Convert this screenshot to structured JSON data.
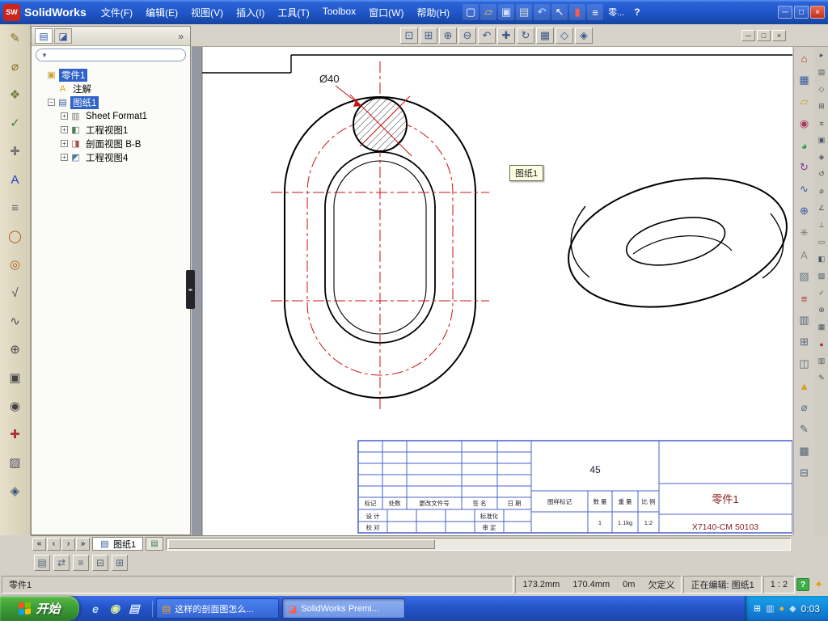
{
  "app": {
    "title": "SolidWorks",
    "logo_text": "SW"
  },
  "menubar": [
    "文件(F)",
    "编辑(E)",
    "视图(V)",
    "插入(I)",
    "工具(T)",
    "Toolbox",
    "窗口(W)",
    "帮助(H)"
  ],
  "titlebar": {
    "part_label": "零...",
    "help_label": "?",
    "tools": [
      {
        "name": "new-document-icon",
        "glyph": "▢",
        "color": "#ffffff"
      },
      {
        "name": "open-icon",
        "glyph": "▱",
        "color": "#f6c744"
      },
      {
        "name": "save-icon",
        "glyph": "▣",
        "color": "#cfe0ff"
      },
      {
        "name": "print-icon",
        "glyph": "▤",
        "color": "#d8dde4"
      },
      {
        "name": "undo-icon",
        "glyph": "↶",
        "color": "#bfe0ff"
      },
      {
        "name": "select-arrow-icon",
        "glyph": "↖",
        "color": "#ffffff"
      },
      {
        "name": "toggle-red-icon",
        "glyph": "▮",
        "color": "#ff5a4a"
      },
      {
        "name": "command-list-icon",
        "glyph": "≡",
        "color": "#ffffff"
      }
    ],
    "window_controls": {
      "minimize": "─",
      "restore": "□",
      "close": "×"
    }
  },
  "doc_toolbar": {
    "tools": [
      {
        "name": "zoom-fit-icon",
        "glyph": "⊡",
        "color": "#3a5a8e"
      },
      {
        "name": "zoom-area-icon",
        "glyph": "⊞",
        "color": "#3a5a8e"
      },
      {
        "name": "zoom-in-icon",
        "glyph": "⊕",
        "color": "#3a5a8e"
      },
      {
        "name": "zoom-out-icon",
        "glyph": "⊖",
        "color": "#3a5a8e"
      },
      {
        "name": "previous-view-icon",
        "glyph": "↶",
        "color": "#3a5a8e"
      },
      {
        "name": "pan-icon",
        "glyph": "✚",
        "color": "#3a5a8e"
      },
      {
        "name": "rotate-view-icon",
        "glyph": "↻",
        "color": "#3a5a8e"
      },
      {
        "name": "standard-views-icon",
        "glyph": "▦",
        "color": "#3a5a8e"
      },
      {
        "name": "wireframe-icon",
        "glyph": "◇",
        "color": "#3a5a8e"
      },
      {
        "name": "shaded-view-icon",
        "glyph": "◈",
        "color": "#3a5a8e"
      }
    ],
    "window_controls": {
      "minimize": "─",
      "restore": "□",
      "close": "×"
    }
  },
  "left_toolbar": [
    {
      "name": "sketch-icon",
      "glyph": "✎",
      "color": "#8a6d1f"
    },
    {
      "name": "smart-dimension-icon",
      "glyph": "⌀",
      "color": "#8a6d1f"
    },
    {
      "name": "model-items-icon",
      "glyph": "❖",
      "color": "#6b7f3a"
    },
    {
      "name": "spell-check-icon",
      "glyph": "✓",
      "color": "#3a7f3a"
    },
    {
      "name": "format-painter-icon",
      "glyph": "✚",
      "color": "#777777"
    },
    {
      "name": "note-icon",
      "glyph": "A",
      "color": "#1b3fbf"
    },
    {
      "name": "linear-note-pattern-icon",
      "glyph": "≡",
      "color": "#666666"
    },
    {
      "name": "balloon-icon",
      "glyph": "◯",
      "color": "#b05a1f"
    },
    {
      "name": "auto-balloon-icon",
      "glyph": "◎",
      "color": "#b05a1f"
    },
    {
      "name": "surface-finish-icon",
      "glyph": "√",
      "color": "#444444"
    },
    {
      "name": "weld-symbol-icon",
      "glyph": "∿",
      "color": "#444444"
    },
    {
      "name": "geometric-tolerance-icon",
      "glyph": "⊕",
      "color": "#444444"
    },
    {
      "name": "datum-feature-icon",
      "glyph": "▣",
      "color": "#444444"
    },
    {
      "name": "hole-callout-icon",
      "glyph": "◉",
      "color": "#444444"
    },
    {
      "name": "center-mark-icon",
      "glyph": "✚",
      "color": "#aa3333"
    },
    {
      "name": "area-hatch-icon",
      "glyph": "▨",
      "color": "#555566"
    },
    {
      "name": "block-icon",
      "glyph": "◈",
      "color": "#335577"
    }
  ],
  "right_toolbar_main": [
    {
      "name": "home-icon",
      "glyph": "⌂",
      "color": "#b03324"
    },
    {
      "name": "sheet-grid-icon",
      "glyph": "▦",
      "color": "#35589e"
    },
    {
      "name": "folder-icon",
      "glyph": "▱",
      "color": "#d8a020"
    },
    {
      "name": "view-orientation-icon",
      "glyph": "◉",
      "color": "#ac3a68"
    },
    {
      "name": "appearance-sphere-icon",
      "glyph": "◕",
      "color": "#2f9d4a"
    },
    {
      "name": "rebuild-icon",
      "glyph": "↻",
      "color": "#7a3a9d"
    },
    {
      "name": "spline-icon",
      "glyph": "∿",
      "color": "#35589e"
    },
    {
      "name": "insert-view-icon",
      "glyph": "⊕",
      "color": "#35589e"
    },
    {
      "name": "pattern-icon",
      "glyph": "✳",
      "color": "#777777"
    },
    {
      "name": "annotation-a-icon",
      "glyph": "A",
      "color": "#888888"
    },
    {
      "name": "hatch-icon",
      "glyph": "▧",
      "color": "#667788"
    },
    {
      "name": "note-list-icon",
      "glyph": "≡",
      "color": "#aa3333"
    },
    {
      "name": "table-icon",
      "glyph": "▥",
      "color": "#556677"
    },
    {
      "name": "grid-plus-icon",
      "glyph": "⊞",
      "color": "#556677"
    },
    {
      "name": "view-box-icon",
      "glyph": "◫",
      "color": "#556677"
    },
    {
      "name": "warning-icon",
      "glyph": "▲",
      "color": "#d8a020"
    },
    {
      "name": "diameter-dimension-icon",
      "glyph": "⌀",
      "color": "#556677"
    },
    {
      "name": "edit-icon",
      "glyph": "✎",
      "color": "#556677"
    },
    {
      "name": "layers-icon",
      "glyph": "▩",
      "color": "#556677"
    },
    {
      "name": "collapse-grid-icon",
      "glyph": "⊟",
      "color": "#556677"
    }
  ],
  "right_toolbar_outer": [
    {
      "name": "panel-toggle-icon",
      "glyph": "▸",
      "color": "#445566"
    },
    {
      "name": "doc-small-icon",
      "glyph": "▤",
      "color": "#445566"
    },
    {
      "name": "sketch-entity-icon",
      "glyph": "◇",
      "color": "#445566"
    },
    {
      "name": "add-grid-icon",
      "glyph": "⊞",
      "color": "#445566"
    },
    {
      "name": "list-small-icon",
      "glyph": "≡",
      "color": "#445566"
    },
    {
      "name": "solid-icon",
      "glyph": "▣",
      "color": "#445566"
    },
    {
      "name": "gem-icon",
      "glyph": "◈",
      "color": "#445566"
    },
    {
      "name": "undo-small-icon",
      "glyph": "↺",
      "color": "#445566"
    },
    {
      "name": "diameter-small-icon",
      "glyph": "⌀",
      "color": "#445566"
    },
    {
      "name": "angle-icon",
      "glyph": "∠",
      "color": "#445566"
    },
    {
      "name": "perpendicular-icon",
      "glyph": "⊥",
      "color": "#445566"
    },
    {
      "name": "rectangle-icon",
      "glyph": "▭",
      "color": "#445566"
    },
    {
      "name": "half-view-icon",
      "glyph": "◧",
      "color": "#445566"
    },
    {
      "name": "hatch-small-icon",
      "glyph": "▨",
      "color": "#445566"
    },
    {
      "name": "check-icon",
      "glyph": "✓",
      "color": "#2f7d3a"
    },
    {
      "name": "plus-icon",
      "glyph": "⊕",
      "color": "#445566"
    },
    {
      "name": "grid-small-icon",
      "glyph": "▦",
      "color": "#445566"
    },
    {
      "name": "record-icon",
      "glyph": "●",
      "color": "#aa3333"
    },
    {
      "name": "table-small-icon",
      "glyph": "▥",
      "color": "#445566"
    },
    {
      "name": "pencil-small-icon",
      "glyph": "✎",
      "color": "#445566"
    }
  ],
  "feature_panel": {
    "tabs": [
      {
        "name": "featuremanager-tab",
        "glyph": "▤"
      },
      {
        "name": "propertymanager-tab",
        "glyph": "◪"
      }
    ],
    "collapse_label": "»",
    "filter_glyph": "▼",
    "tree": {
      "root": {
        "label": "零件1",
        "glyph": "▣"
      },
      "annotations": {
        "label": "注解",
        "glyph": "A"
      },
      "sheet": {
        "label": "图纸1",
        "glyph": "▤",
        "expander": "−"
      },
      "children": [
        {
          "label": "Sheet Format1",
          "glyph": "▥",
          "expander": "+"
        },
        {
          "label": "工程视图1",
          "glyph": "◧",
          "expander": "+"
        },
        {
          "label": "剖面视图 B-B",
          "glyph": "◨",
          "expander": "+"
        },
        {
          "label": "工程视图4",
          "glyph": "◩",
          "expander": "+"
        }
      ]
    }
  },
  "drawing": {
    "dimension_label": "Ø40",
    "tooltip": "图纸1",
    "line_colors": {
      "outline": "#000000",
      "centerline": "#cc1111",
      "table": "#4a5fd0"
    },
    "title_block": {
      "material": "45",
      "part_name": "零件1",
      "drawing_number": "X7140-CM 50103",
      "change_header": [
        "标记",
        "处数",
        "更改文件号",
        "签 名",
        "日 期"
      ],
      "sig_labels_left": [
        "设 计",
        "校 对"
      ],
      "sig_labels_right": [
        "标准化",
        "审 定"
      ],
      "stamp_header": [
        "图样标记",
        "数 量",
        "重 量",
        "比 例"
      ],
      "stamp_values": [
        "",
        "1",
        "1.1kg",
        "1:2"
      ]
    }
  },
  "sheet_bar": {
    "nav": [
      {
        "name": "first-sheet-button",
        "glyph": "«"
      },
      {
        "name": "prev-sheet-button",
        "glyph": "‹"
      },
      {
        "name": "next-sheet-button",
        "glyph": "›"
      },
      {
        "name": "last-sheet-button",
        "glyph": "»"
      }
    ],
    "tab": {
      "label": "图纸1",
      "glyph": "▤"
    },
    "extra_tab_glyph": "▤"
  },
  "lower_toolbar": [
    {
      "name": "comment-icon",
      "glyph": "▤",
      "color": "#556677"
    },
    {
      "name": "swap-icon",
      "glyph": "⇄",
      "color": "#556677"
    },
    {
      "name": "line-format-icon",
      "glyph": "≡",
      "color": "#556677"
    },
    {
      "name": "layer-icon",
      "glyph": "⊟",
      "color": "#556677"
    },
    {
      "name": "grid-icon",
      "glyph": "⊞",
      "color": "#556677"
    }
  ],
  "status_bar": {
    "part": "零件1",
    "x": "173.2mm",
    "y": "170.4mm",
    "z": "0m",
    "dof": "欠定义",
    "editing": "正在编辑: 图纸1",
    "scale": "1 : 2",
    "help_glyph": "?",
    "lock_glyph": "✦"
  },
  "taskbar": {
    "start_label": "开始",
    "quick_launch": [
      {
        "name": "internet-explorer-icon",
        "glyph": "e",
        "color": "#bfe0ff"
      },
      {
        "name": "messenger-icon",
        "glyph": "◉",
        "color": "#d8e8a0"
      },
      {
        "name": "document-shortcut-icon",
        "glyph": "▤",
        "color": "#cfe0ff"
      }
    ],
    "tasks": [
      {
        "label": "这样的剖面图怎么...",
        "icon_glyph": "▤",
        "icon_color": "#f0a030"
      },
      {
        "label": "SolidWorks Premi...",
        "icon_glyph": "◪",
        "icon_color": "#ff5a4a"
      }
    ],
    "tray_icons": [
      {
        "name": "language-icon",
        "glyph": "⊞",
        "color": "#ffffff"
      },
      {
        "name": "device-icon",
        "glyph": "▥",
        "color": "#cfe0ff"
      },
      {
        "name": "antivirus-icon",
        "glyph": "●",
        "color": "#f0b030"
      },
      {
        "name": "network-icon",
        "glyph": "◆",
        "color": "#bfe0ff"
      }
    ],
    "time": "0:03"
  }
}
